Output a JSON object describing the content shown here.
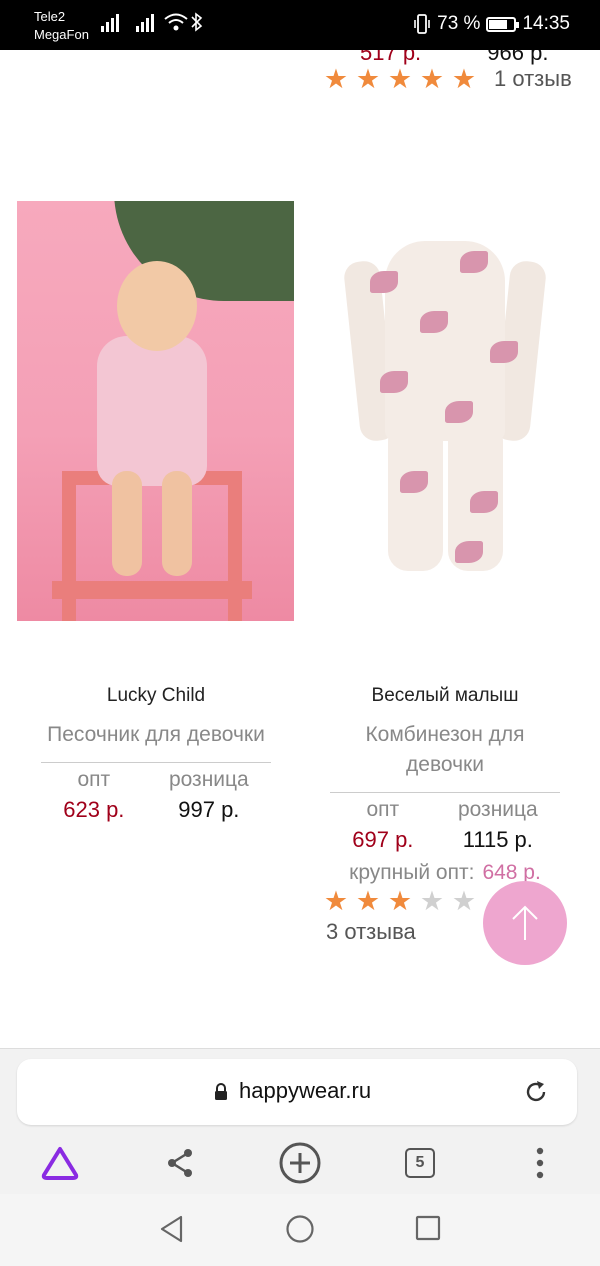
{
  "status_bar": {
    "carrier1": "Tele2",
    "carrier2": "MegaFon",
    "battery_percent": "73 %",
    "battery_level": 0.73,
    "time": "14:35"
  },
  "previous_item": {
    "wholesale_price": "517 р.",
    "retail_price": "966 р.",
    "rating_stars": 5,
    "review_count": "1 отзыв"
  },
  "products": [
    {
      "brand": "Lucky Child",
      "title": "Песочник для девочки",
      "wholesale_label": "опт",
      "retail_label": "розница",
      "wholesale_price": "623 р.",
      "retail_price": "997 р."
    },
    {
      "brand": "Веселый малыш",
      "title": "Комбинезон для девочки",
      "wholesale_label": "опт",
      "retail_label": "розница",
      "wholesale_price": "697 р.",
      "retail_price": "1115 р.",
      "bulk_label": "крупный опт:",
      "bulk_price": "648 р.",
      "rating_stars": 3,
      "rating_max": 5,
      "review_count": "3 отзыва"
    }
  ],
  "browser": {
    "url": "happywear.ru",
    "tab_count": "5"
  },
  "icons": {
    "back_to_top": "arrow-up-icon",
    "lock": "lock-icon",
    "reload": "reload-icon",
    "assistant": "alice-triangle-icon",
    "share": "share-icon",
    "new_tab": "plus-circle-icon",
    "tabs": "tabs-icon",
    "menu": "kebab-menu-icon"
  },
  "colors": {
    "star_active": "#f08a3c",
    "star_inactive": "#d0d0d0",
    "wholesale_price": "#a0001a",
    "bulk_price": "#d06fa3",
    "fab": "#eea6cf",
    "assistant_icon": "#8a2be2"
  }
}
